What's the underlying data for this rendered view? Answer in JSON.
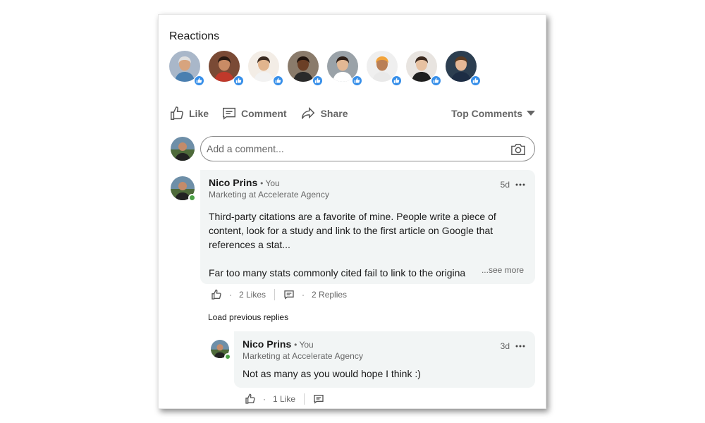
{
  "reactions": {
    "title": "Reactions",
    "people": [
      {
        "avatar_color": "#a9b7c9",
        "skin": "#d7a47e",
        "hair": "#e0e0e0",
        "shirt": "#4a7fb0"
      },
      {
        "avatar_color": "#7a4a35",
        "skin": "#c98b65",
        "hair": "#2a1a12",
        "shirt": "#c0392b"
      },
      {
        "avatar_color": "#f3ede6",
        "skin": "#e1b48d",
        "hair": "#3a2a20",
        "shirt": "#f2f2f2"
      },
      {
        "avatar_color": "#8a7b6b",
        "skin": "#6b3f26",
        "hair": "#1f130d",
        "shirt": "#2a2a2a"
      },
      {
        "avatar_color": "#9aa2a8",
        "skin": "#e3b894",
        "hair": "#2e1f17",
        "shirt": "#ffffff"
      },
      {
        "avatar_color": "#efefef",
        "skin": "#b97f56",
        "hair": "#f2a33a",
        "shirt": "#e9e9e9"
      },
      {
        "avatar_color": "#e8e4e0",
        "skin": "#e7c1a1",
        "hair": "#3a281d",
        "shirt": "#1f1f1f"
      },
      {
        "avatar_color": "#2c3e50",
        "skin": "#e6b896",
        "hair": "#5a3a22",
        "shirt": "#1d2d44"
      }
    ]
  },
  "actions": {
    "like": "Like",
    "comment": "Comment",
    "share": "Share",
    "sort": "Top Comments"
  },
  "composer": {
    "placeholder": "Add a comment..."
  },
  "comments": [
    {
      "author": "Nico Prins",
      "tag": "• You",
      "headline": "Marketing at Accelerate Agency",
      "age": "5d",
      "text1": "Third-party citations are a favorite of mine. People write a piece of content, look for a study and link to the first article on Google that references a stat...",
      "text2": "Far too many stats commonly cited fail to link to the origina",
      "see_more": "...see more",
      "likes": "2 Likes",
      "replies": "2 Replies"
    }
  ],
  "load_previous": "Load previous replies",
  "reply": {
    "author": "Nico Prins",
    "tag": "• You",
    "headline": "Marketing at Accelerate Agency",
    "age": "3d",
    "text": "Not as many as you would hope I think :)",
    "likes": "1 Like"
  },
  "colors": {
    "like_blue": "#378fe9",
    "online_green": "#4ba146",
    "bubble_bg": "#f2f5f5"
  }
}
